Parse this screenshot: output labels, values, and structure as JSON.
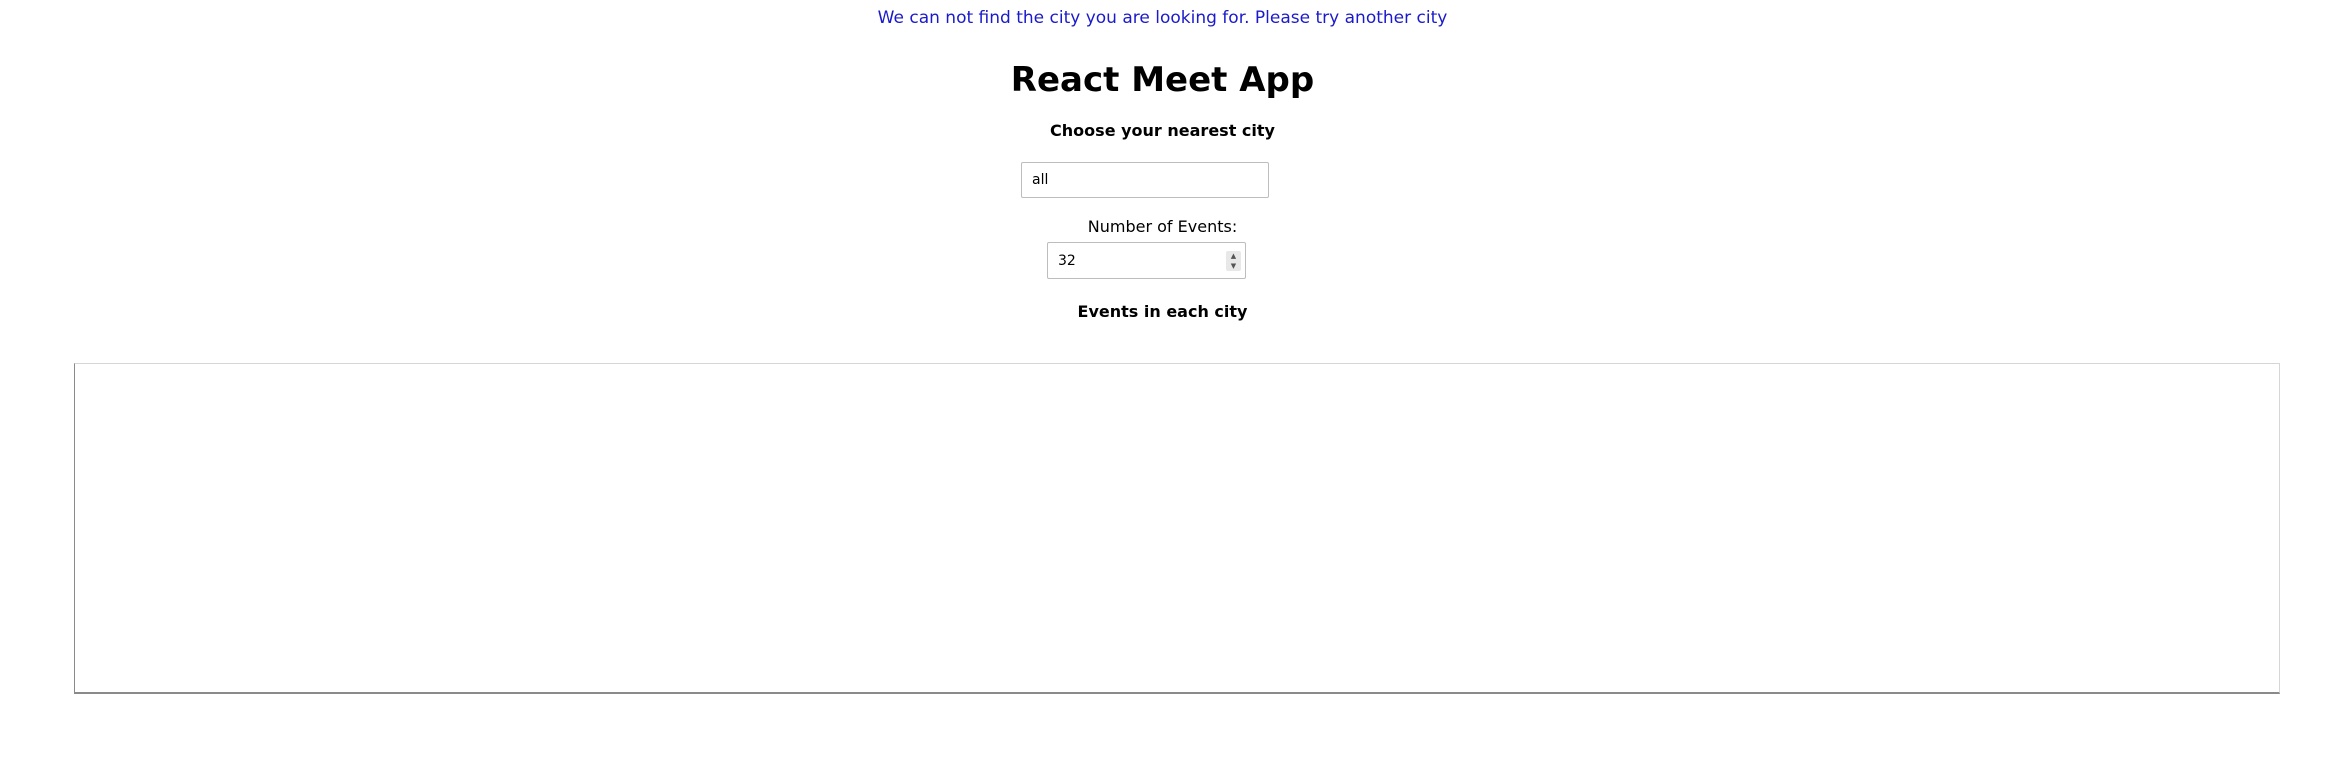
{
  "alert": {
    "message": "We can not find the city you are looking for. Please try another city",
    "color": "#1a1acc"
  },
  "app": {
    "title": "React Meet App"
  },
  "city_search": {
    "label": "Choose your nearest city",
    "value": "all"
  },
  "number_of_events": {
    "label": "Number of Events:",
    "value": "32"
  },
  "chart_section": {
    "title": "Events in each city"
  }
}
